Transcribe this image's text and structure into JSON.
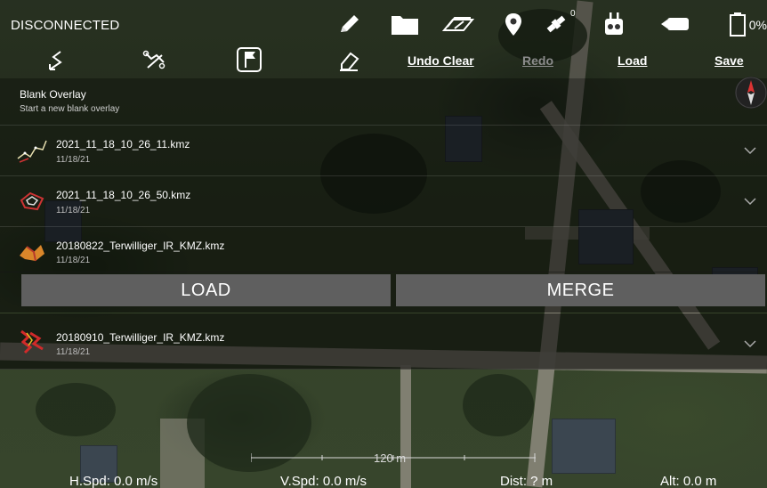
{
  "status": {
    "connection": "DISCONNECTED",
    "gps_count": "0",
    "battery": "0%"
  },
  "toolbar": {
    "undo_clear": "Undo Clear",
    "redo": "Redo",
    "load": "Load",
    "save": "Save"
  },
  "overlays": {
    "blank": {
      "title": "Blank Overlay",
      "subtitle": "Start a new blank overlay"
    },
    "items": [
      {
        "name": "2021_11_18_10_26_11.kmz",
        "date": "11/18/21"
      },
      {
        "name": "2021_11_18_10_26_50.kmz",
        "date": "11/18/21"
      },
      {
        "name": "20180822_Terwilliger_IR_KMZ.kmz",
        "date": "11/18/21"
      },
      {
        "name": "20180910_Terwilliger_IR_KMZ.kmz",
        "date": "11/18/21"
      }
    ],
    "actions": {
      "load": "LOAD",
      "merge": "MERGE"
    }
  },
  "map": {
    "scale": "120 m"
  },
  "telemetry": {
    "hspd": "H.Spd: 0.0 m/s",
    "vspd": "V.Spd: 0.0 m/s",
    "dist": "Dist: ? m",
    "alt": "Alt: 0.0 m"
  },
  "icons": {
    "status": [
      "pencil-icon",
      "folder-icon",
      "layers-icon",
      "location-pin-icon",
      "satellite-icon",
      "remote-controller-icon",
      "camera-icon",
      "battery-icon"
    ],
    "tools": [
      "draw-path-icon",
      "route-icon",
      "flag-icon",
      "eraser-icon"
    ]
  },
  "colors": {
    "overlay": "#000000",
    "button": "#5f5f5f",
    "disabled": "#8c8c8c"
  }
}
